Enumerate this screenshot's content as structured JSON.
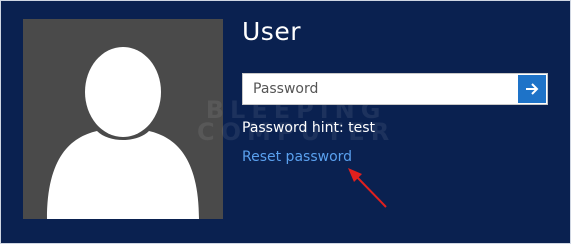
{
  "user": {
    "name": "User"
  },
  "password": {
    "placeholder": "Password",
    "value": ""
  },
  "hint": {
    "text": "Password hint: test"
  },
  "reset": {
    "label": "Reset password"
  },
  "watermark": {
    "line1": "BLEEPING",
    "line2": "COMPUTER"
  },
  "icons": {
    "submit": "arrow-right-icon",
    "avatar": "user-silhouette-icon",
    "annotation": "red-arrow-icon"
  },
  "colors": {
    "background": "#0a2150",
    "avatar_bg": "#4a4a4a",
    "submit_bg": "#1e73c8",
    "link": "#5aa0ee",
    "annotation": "#e0201e"
  }
}
